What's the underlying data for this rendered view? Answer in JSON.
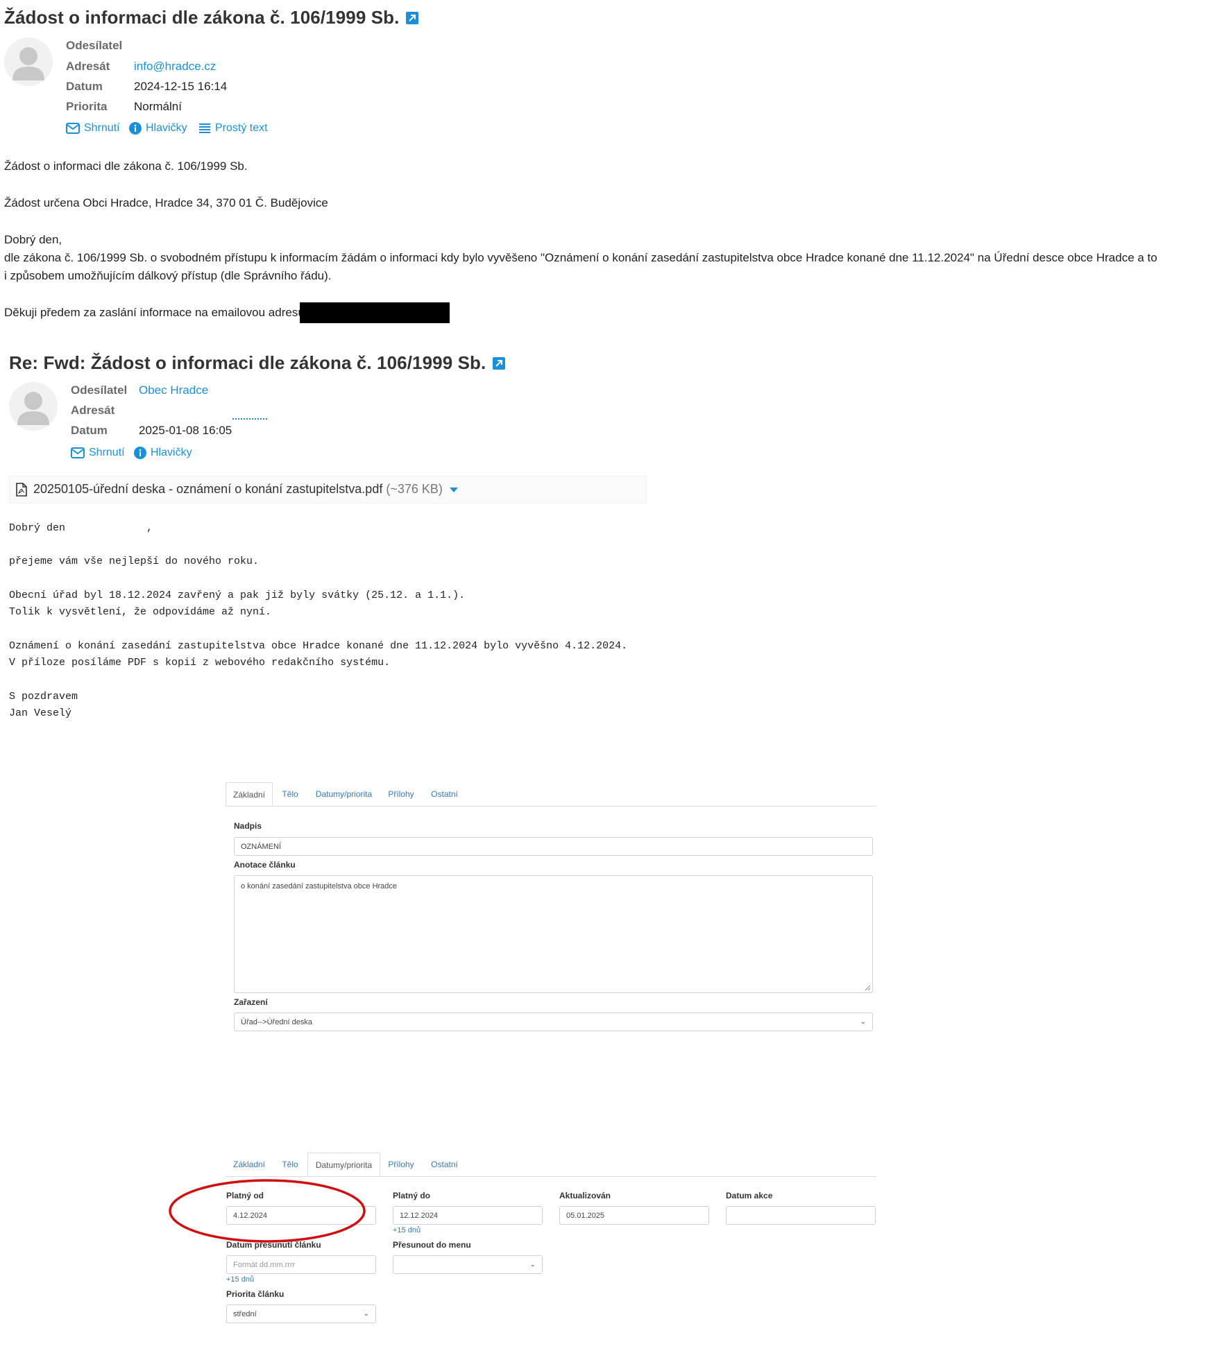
{
  "email1": {
    "subject": "Žádost o informaci dle zákona č. 106/1999 Sb.",
    "labels": {
      "sender": "Odesílatel",
      "recipient": "Adresát",
      "date": "Datum",
      "priority": "Priorita"
    },
    "recipient": "info@hradce.cz",
    "date": "2024-12-15 16:14",
    "priority": "Normální",
    "actions": {
      "summary": "Shrnutí",
      "headers": "Hlavičky",
      "plain": "Prostý text"
    },
    "body": {
      "line1": "Žádost o informaci dle zákona č. 106/1999 Sb.",
      "line2": "Žádost určena Obci Hradce, Hradce 34, 370 01 Č. Budějovice",
      "line3": "Dobrý den,",
      "line4": "dle zákona č. 106/1999 Sb. o svobodném přístupu k informacím žádám o informaci kdy bylo vyvěšeno \"Oznámení o konání zasedání zastupitelstva obce Hradce konané dne 11.12.2024\" na Úřední desce obce Hradce a to",
      "line5": "i způsobem umožňujícím dálkový přístup (dle Správního řádu).",
      "line6": "Děkuji předem za zaslání informace na emailovou adresu:"
    }
  },
  "email2": {
    "subject": "Re: Fwd: Žádost o informaci dle zákona č. 106/1999 Sb.",
    "labels": {
      "sender": "Odesílatel",
      "recipient": "Adresát",
      "date": "Datum"
    },
    "sender": "Obec Hradce",
    "date": "2025-01-08 16:05",
    "actions": {
      "summary": "Shrnutí",
      "headers": "Hlavičky"
    },
    "attachment": {
      "name": "20250105-úřední deska - oznámení o konání zastupitelstva.pdf",
      "size": "(~376 KB)"
    },
    "body": {
      "l1": "Dobrý den             ,",
      "l2": "přejeme vám vše nejlepší do nového roku.",
      "l3": "Obecní úřad byl 18.12.2024 zavřený a pak již byly svátky (25.12. a 1.1.).",
      "l4": "Tolik k vysvětlení, že odpovídáme až nyní.",
      "l5": "Oznámení o konání zasedání zastupitelstva obce Hradce konané dne 11.12.2024 bylo vyvěšno 4.12.2024.",
      "l6": "V příloze posíláme PDF s kopií z webového redakčního systému.",
      "l7": "S pozdravem",
      "l8": "Jan Veselý"
    }
  },
  "cms1": {
    "tabs": [
      "Základní",
      "Tělo",
      "Datumy/priorita",
      "Přílohy",
      "Ostatní"
    ],
    "title_label": "Nadpis",
    "title_value": "OZNÁMENÍ",
    "annotation_label": "Anotace článku",
    "annotation_value": "o konání zasedání zastupitelstva obce Hradce",
    "category_label": "Zařazení",
    "category_value": "Úřad-->Úřední deska"
  },
  "cms2": {
    "tabs": [
      "Základní",
      "Tělo",
      "Datumy/priorita",
      "Přílohy",
      "Ostatní"
    ],
    "valid_from_label": "Platný od",
    "valid_from_value": "4.12.2024",
    "valid_to_label": "Platný do",
    "valid_to_value": "12.12.2024",
    "updated_label": "Aktualizován",
    "updated_value": "05.01.2025",
    "event_date_label": "Datum akce",
    "plus15": "+15 dnů",
    "move_date_label": "Datum přesunutí článku",
    "move_date_placeholder": "Formát dd.mm.rrrr",
    "move_menu_label": "Přesunout do menu",
    "priority_label": "Priorita článku",
    "priority_value": "střední"
  },
  "colors": {
    "link": "#1a90d9",
    "cms_link": "#3578b5",
    "highlight_circle": "#d01010"
  }
}
